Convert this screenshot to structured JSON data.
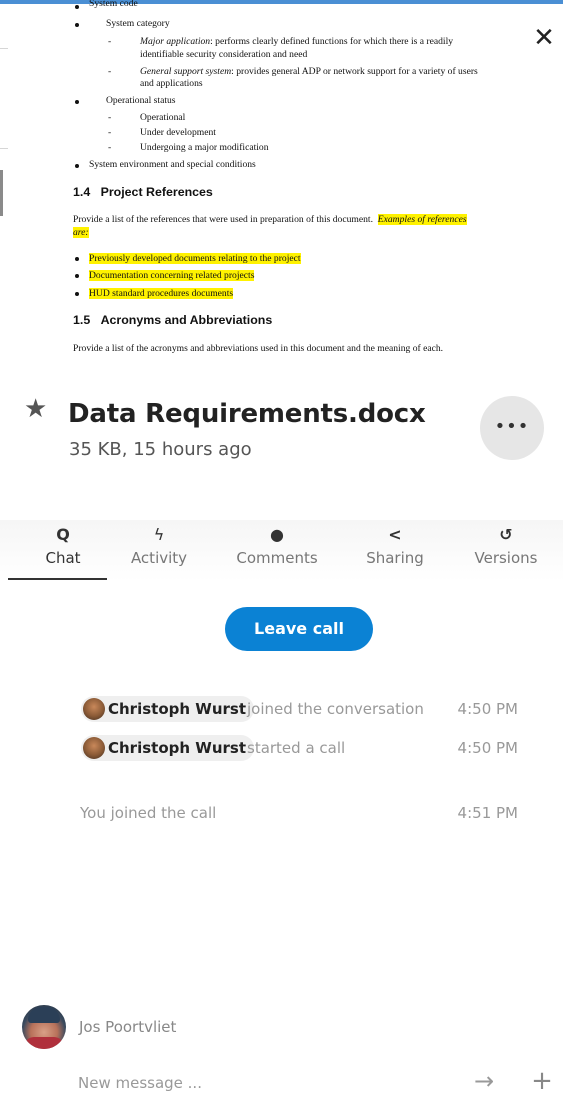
{
  "document_preview": {
    "lines": {
      "system_code": "System code",
      "system_category": "System category",
      "major_app_term": "Major application",
      "major_app_text": ": performs clearly defined functions for which there is a readily",
      "major_app_text2": "identifiable security consideration and need",
      "general_support_term": "General support system",
      "general_support_text": ": provides general ADP or network support for a variety of users",
      "general_support_text2": "and applications",
      "operational_status": "Operational status",
      "status_operational": "Operational",
      "status_under_dev": "Under development",
      "status_major_mod": "Undergoing a major modification",
      "system_environment": "System environment and special conditions"
    },
    "section_1_4": {
      "heading_num": "1.4",
      "heading": "Project References",
      "intro": "Provide a list of the references that were used in preparation of this document.",
      "examples_label": "Examples of references",
      "examples_label2": "are:",
      "items": [
        "Previously developed documents relating to the project",
        "Documentation concerning related projects",
        "HUD standard procedures documents"
      ]
    },
    "section_1_5": {
      "heading_num": "1.5",
      "heading": "Acronyms and Abbreviations",
      "text": "Provide a list of the acronyms and abbreviations used in this document and the meaning of each."
    }
  },
  "close_icon": "close-icon",
  "file": {
    "title": "Data Requirements.docx",
    "meta": "35 KB, 15 hours ago",
    "more_label": "•••"
  },
  "tabs": [
    {
      "label": "Chat",
      "icon": "search-icon",
      "glyph": "Q"
    },
    {
      "label": "Activity",
      "icon": "lightning-icon",
      "glyph": "ϟ"
    },
    {
      "label": "Comments",
      "icon": "comment-icon",
      "glyph": "●"
    },
    {
      "label": "Sharing",
      "icon": "share-icon",
      "glyph": "<"
    },
    {
      "label": "Versions",
      "icon": "history-icon",
      "glyph": "↺"
    }
  ],
  "call": {
    "leave_label": "Leave call"
  },
  "messages": [
    {
      "user": "Christoph Wurst",
      "action": "joined the conversation",
      "time": "4:50 PM"
    },
    {
      "user": "Christoph Wurst",
      "action": "started a call",
      "time": "4:50 PM"
    }
  ],
  "system_message": {
    "text": "You joined the call",
    "time": "4:51 PM"
  },
  "composer": {
    "current_user": "Jos Poortvliet",
    "placeholder": "New message ...",
    "send_glyph": "→",
    "add_glyph": "+"
  },
  "colors": {
    "accent": "#0b82d4",
    "highlight": "#fff200",
    "topbar": "#4a8fd4"
  }
}
